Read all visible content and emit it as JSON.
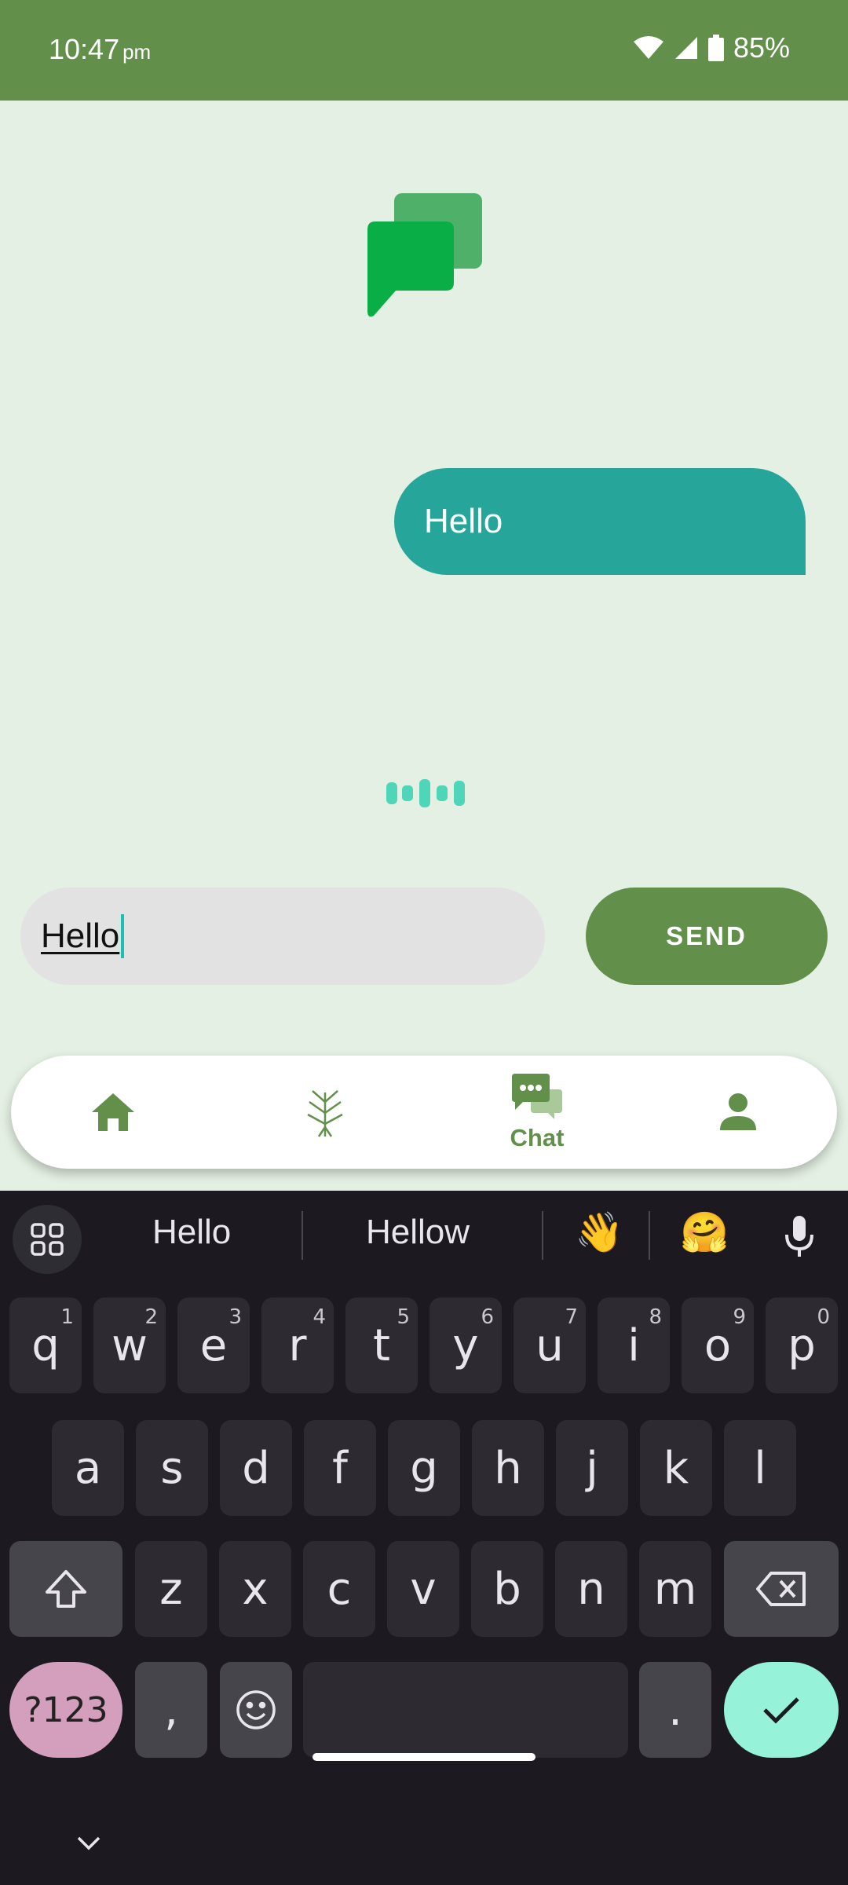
{
  "status_bar": {
    "time": "10:47",
    "ampm": "pm",
    "battery": "85%"
  },
  "chat": {
    "messages": [
      {
        "text": "Hello",
        "from": "user"
      }
    ]
  },
  "composer": {
    "value": "Hello",
    "send_label": "SEND"
  },
  "bottom_nav": {
    "items": [
      {
        "icon": "home-icon"
      },
      {
        "icon": "plant-icon"
      },
      {
        "icon": "chat-icon",
        "label": "Chat",
        "active": true
      },
      {
        "icon": "person-icon"
      }
    ]
  },
  "keyboard": {
    "suggestions": [
      "Hello",
      "Hellow"
    ],
    "emoji_suggestions": [
      "👋",
      "🤗"
    ],
    "row1": [
      {
        "k": "q",
        "n": "1"
      },
      {
        "k": "w",
        "n": "2"
      },
      {
        "k": "e",
        "n": "3"
      },
      {
        "k": "r",
        "n": "4"
      },
      {
        "k": "t",
        "n": "5"
      },
      {
        "k": "y",
        "n": "6"
      },
      {
        "k": "u",
        "n": "7"
      },
      {
        "k": "i",
        "n": "8"
      },
      {
        "k": "o",
        "n": "9"
      },
      {
        "k": "p",
        "n": "0"
      }
    ],
    "row2": [
      "a",
      "s",
      "d",
      "f",
      "g",
      "h",
      "j",
      "k",
      "l"
    ],
    "row3": [
      "z",
      "x",
      "c",
      "v",
      "b",
      "n",
      "m"
    ],
    "symbols_label": "?123",
    "comma": ",",
    "period": "."
  },
  "colors": {
    "primary": "#62904b",
    "bubble": "#26a69a",
    "background": "#e4f0e4",
    "keyboard": "#1c1a20"
  }
}
